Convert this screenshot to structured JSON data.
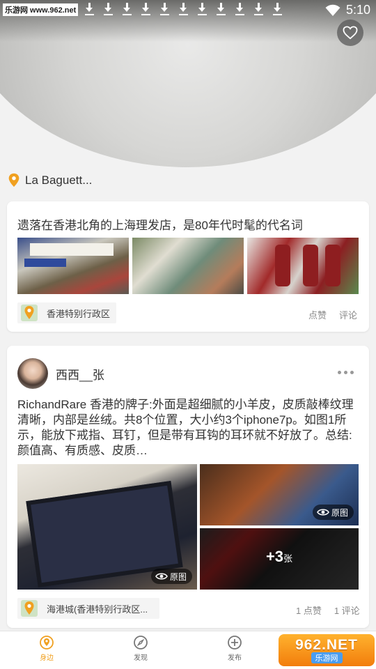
{
  "status_bar": {
    "watermark": "乐游网 www.962.net",
    "time": "5:10",
    "download_icon_count": 11
  },
  "header": {
    "favorite_icon": "heart-outline-icon"
  },
  "location": {
    "name": "La Baguett..."
  },
  "post1": {
    "title": "遗落在香港北角的上海理发店，是80年代时髦的代名词",
    "location": "香港特别行政区",
    "like_label": "点赞",
    "comment_label": "评论"
  },
  "post2": {
    "author": "西西__张",
    "body": "RichandRare 香港的牌子:外面是超细腻的小羊皮，皮质敲棒纹理清晰，内部是丝绒。共8个位置，大小约3个iphone7p。如图1所示，能放下戒指、耳钉，但是带有耳钩的耳环就不好放了。总结:颜值高、有质感、皮质…",
    "original_label_1": "原图",
    "original_label_2": "原图",
    "more_count": "+3",
    "more_unit": "张",
    "location": "海港城(香港特别行政区...",
    "likes": "1 点赞",
    "comments": "1 评论"
  },
  "bottom_nav": {
    "items": [
      {
        "label": "身边",
        "icon": "nearby-icon",
        "active": true
      },
      {
        "label": "发现",
        "icon": "compass-icon",
        "active": false
      },
      {
        "label": "发布",
        "icon": "plus-circle-icon",
        "active": false
      }
    ]
  },
  "watermark_bottom": {
    "big": "962.NET",
    "small": "乐游网"
  },
  "colors": {
    "accent": "#f0a020",
    "text": "#333333",
    "muted": "#888888"
  }
}
